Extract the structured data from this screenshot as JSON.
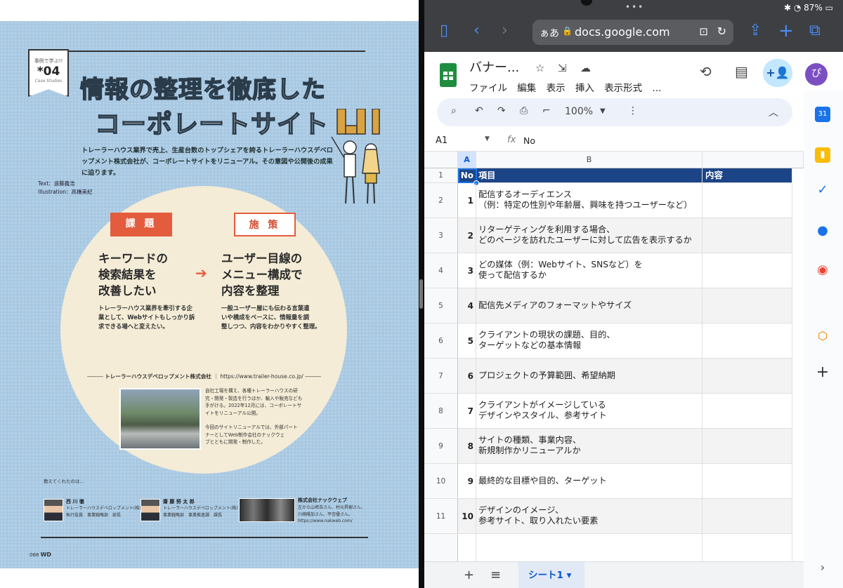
{
  "magazine": {
    "badge": {
      "top": "事例で学ぶ!!",
      "num": "*04",
      "sub": "Case Studies"
    },
    "title_line1": "情報の整理を徹底した",
    "title_line2": "コーポレートサイト",
    "lead": "トレーラーハウス業界で売上、生産台数のトップシェアを誇るトレーラーハウスデベロップメント株式会社が、コーポレートサイトをリニューアル。その意図や公開後の成果に迫ります。",
    "credit_text": "Text：遠藤義浩",
    "credit_illus": "Illustration：高橋美紀",
    "issue_tag": "課 題",
    "issue_head": "キーワードの\n検索結果を\n改善したい",
    "issue_body": "トレーラーハウス業界を牽引する企\n業として、Webサイトもしっかり訴\n求できる場へと変えたい。",
    "measure_tag": "施 策",
    "measure_head": "ユーザー目線の\nメニュー構成で\n内容を整理",
    "measure_body": "一般ユーザー層にも伝わる言葉遣\nいや構成をベースに、情報量を調\n整しつつ、内容をわかりやすく整理。",
    "arrow": "➔",
    "company": "トレーラーハウスデベロップメント株式会社",
    "company_url": "https://www.trailer-house.co.jp/",
    "company_desc1": "自社工場を構え、各種トレーラーハウスの研\n究・開発・製造を行うほか、輸入や販売なども\n手がける。2022年12月には、コーポレートサ\nイトをリニューアル公開。",
    "company_desc2": "今回のサイトリニューアルでは、外部パート\nナーとしてWeb制作会社のナックウェ\nブとともに開発・制作した。",
    "taught_by": "教えてくれたのは…",
    "persons": [
      {
        "name": "西 川 徹",
        "role": "トレーラーハウスデベロップメント(株)\n執行役員　事業戦略部　部長"
      },
      {
        "name": "齋 藤 努 太 郎",
        "role": "トレーラーハウスデベロップメント(株)\n事業戦略部　事業推進課　課長"
      },
      {
        "name": "株式会社ナックウェブ",
        "role": "左から山﨑浩さん、村元昇樹さん、\n川崎陽加さん、平枩優さん。\nhttps://www.nakweb.com/"
      }
    ],
    "page_number": "068",
    "page_brand": "WD"
  },
  "safari": {
    "battery": "87%",
    "aa_label": "ぁあ",
    "url": "docs.google.com"
  },
  "sheets": {
    "doc_title": "バナー...",
    "menu": [
      "ファイル",
      "編集",
      "表示",
      "挿入",
      "表示形式",
      "..."
    ],
    "zoom": "100%",
    "cell_ref": "A1",
    "formula_value": "No",
    "col_headers": [
      "A",
      "B"
    ],
    "header_row": {
      "num": "1",
      "a": "No",
      "b": "項目",
      "c": "内容"
    },
    "rows": [
      {
        "num": "2",
        "no": "1",
        "item": "配信するオーディエンス\n（例：特定の性別や年齢層、興味を持つユーザーなど）"
      },
      {
        "num": "3",
        "no": "2",
        "item": "リターゲティングを利用する場合、\nどのページを訪れたユーザーに対して広告を表示するか"
      },
      {
        "num": "4",
        "no": "3",
        "item": "どの媒体（例：Webサイト、SNSなど）を\n使って配信するか"
      },
      {
        "num": "5",
        "no": "4",
        "item": "配信先メディアのフォーマットやサイズ"
      },
      {
        "num": "6",
        "no": "5",
        "item": "クライアントの現状の課題、目的、\nターゲットなどの基本情報"
      },
      {
        "num": "7",
        "no": "6",
        "item": "プロジェクトの予算範囲、希望納期"
      },
      {
        "num": "8",
        "no": "7",
        "item": "クライアントがイメージしている\nデザインやスタイル、参考サイト"
      },
      {
        "num": "9",
        "no": "8",
        "item": "サイトの種類、事業内容、\n新規制作かリニューアルか"
      },
      {
        "num": "10",
        "no": "9",
        "item": "最終的な目標や目的、ターゲット"
      },
      {
        "num": "11",
        "no": "10",
        "item": "デザインのイメージ、\n参考サイト、取り入れたい要素"
      }
    ],
    "sheet_tab": "シート1"
  },
  "colors": {
    "header_blue": "#1c4587",
    "accent_red": "#e45c3e",
    "sheets_green": "#1e8e3e"
  }
}
